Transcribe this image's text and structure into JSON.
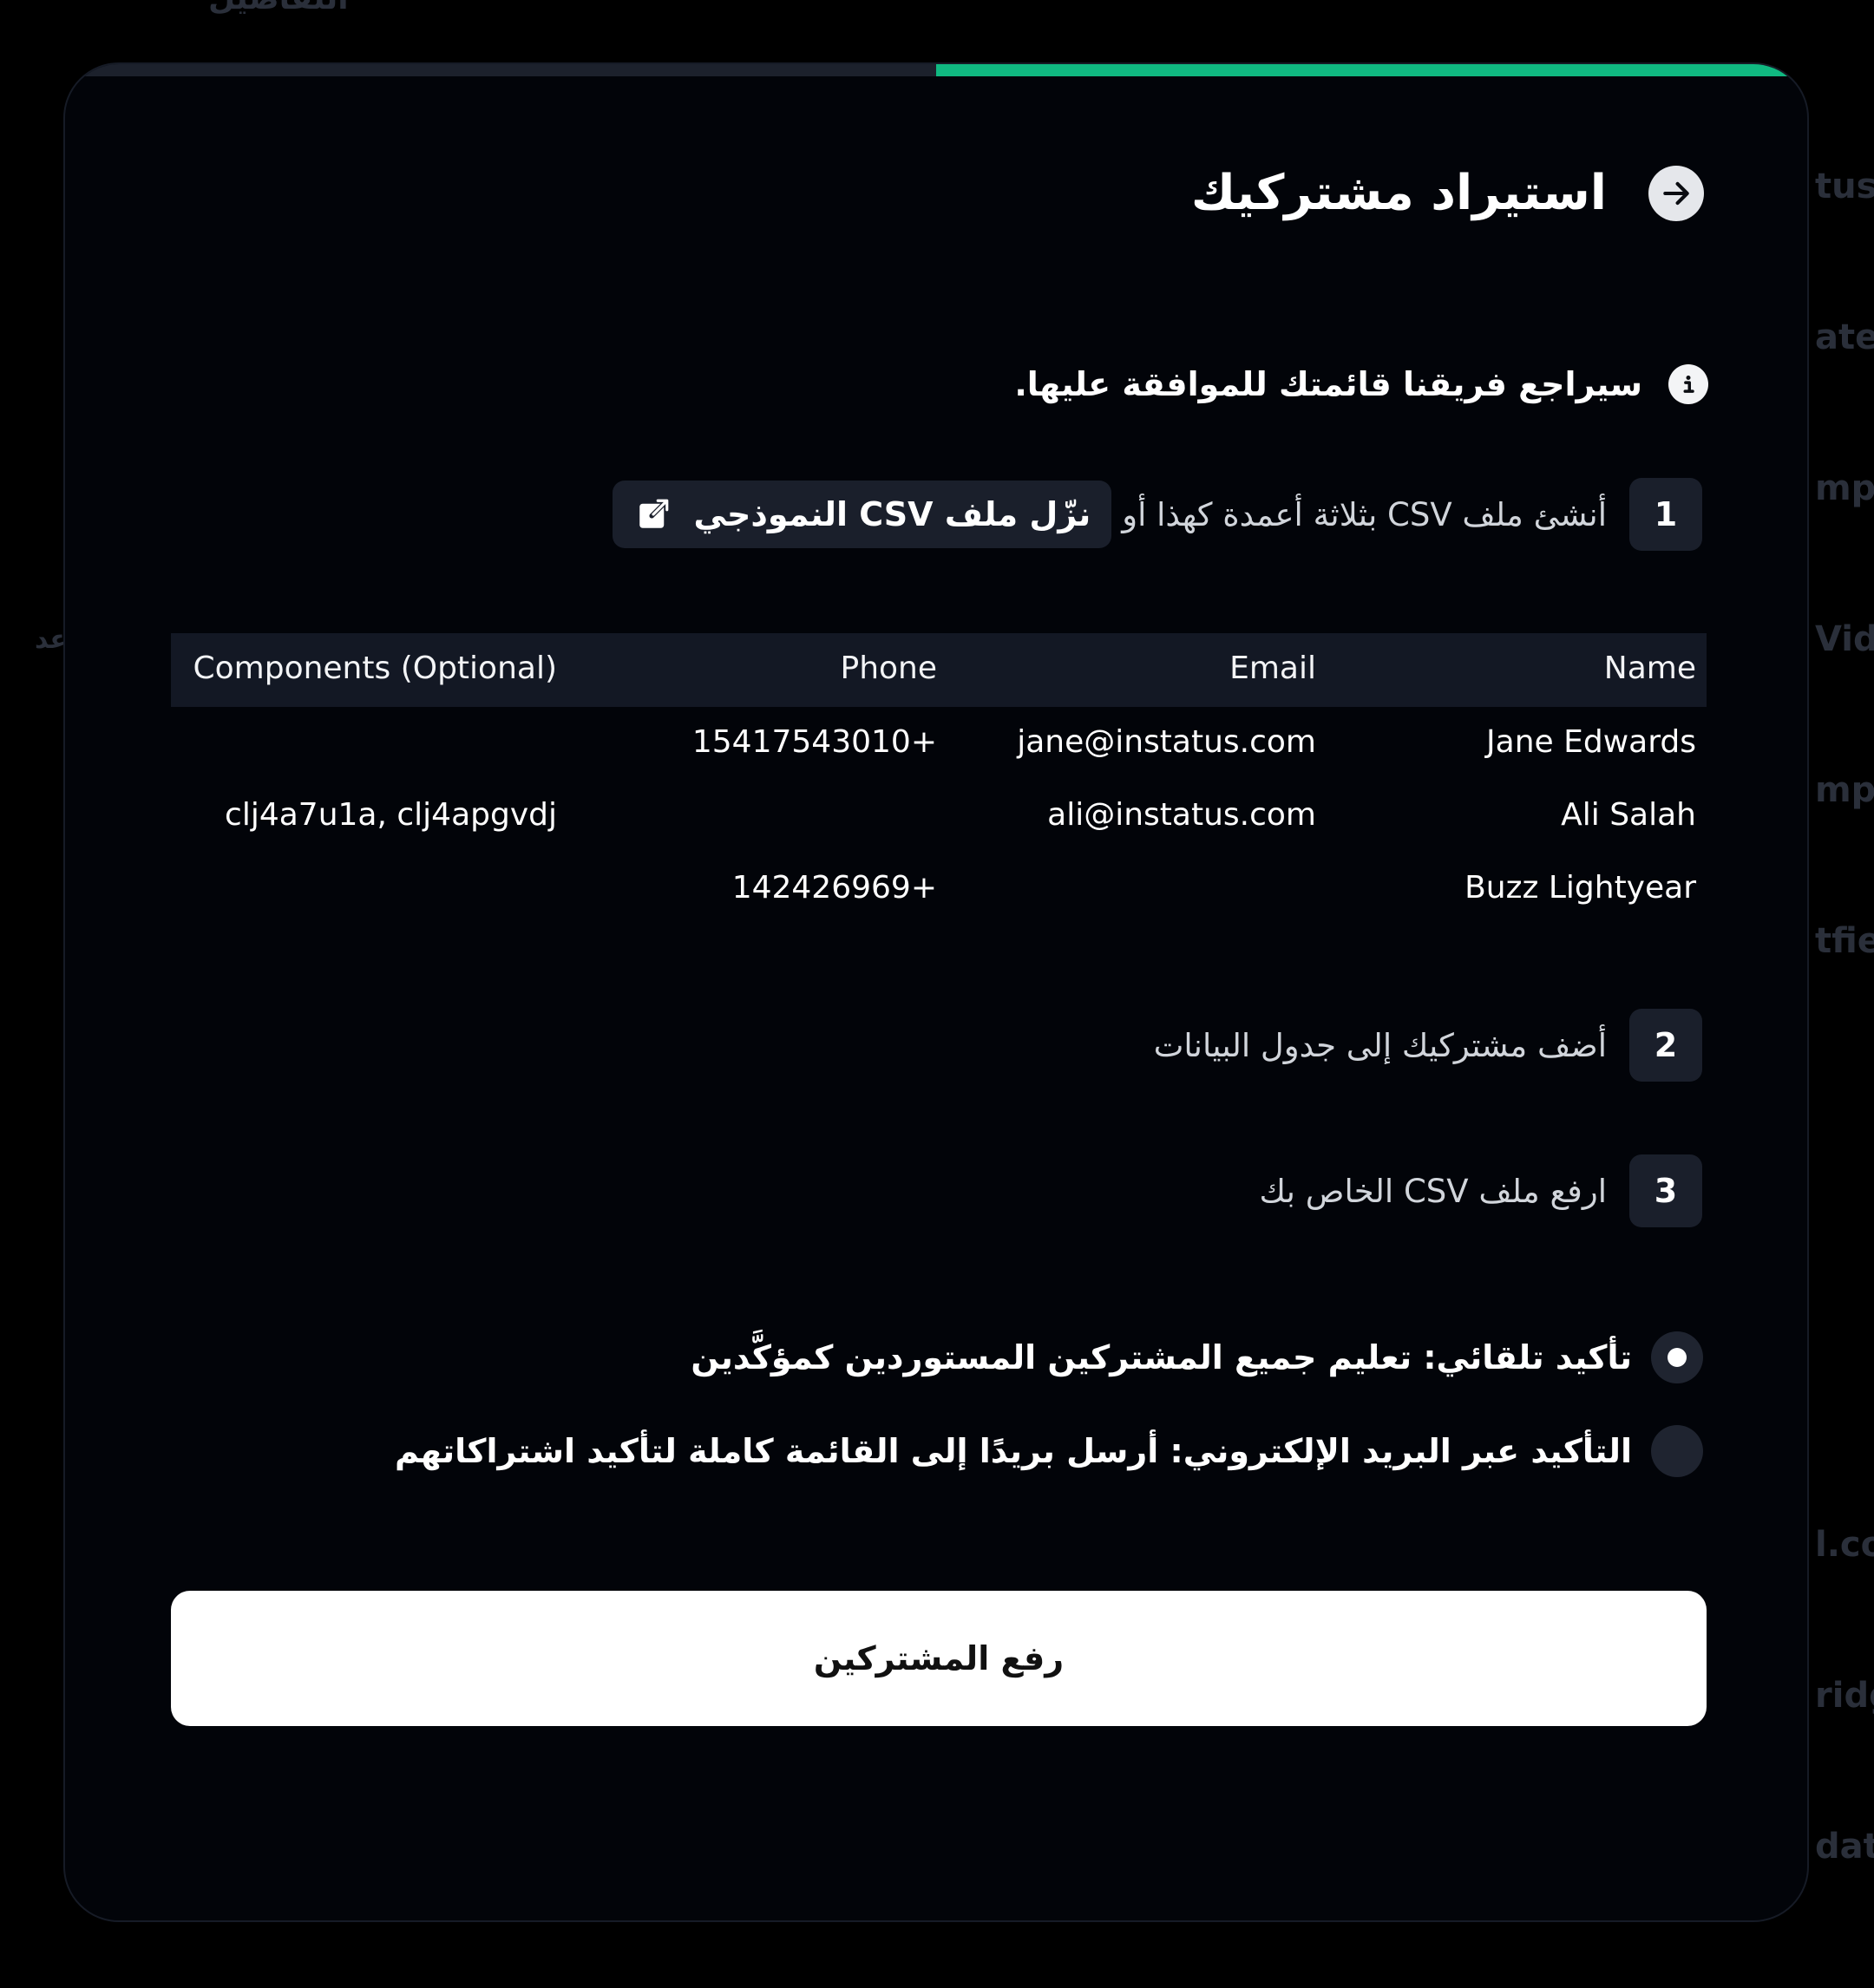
{
  "background": {
    "fragments": [
      "التفاصيل",
      "tus(",
      "aten",
      "mpl",
      "Vid",
      "mpl",
      "tfiel",
      "l.co",
      "ridg",
      "date",
      "عد"
    ]
  },
  "modal": {
    "progress": 0.5,
    "title": "استيراد مشتركيك",
    "back_icon": "arrow-right-icon",
    "info_icon": "info-icon",
    "note": "سيراجع فريقنا قائمتك للموافقة عليها.",
    "steps": [
      {
        "number": "1",
        "text": "أنشئ ملف CSV بثلاثة أعمدة كهذا أو",
        "button_label": "نزّل ملف CSV النموذجي",
        "button_icon": "external-link-icon"
      },
      {
        "number": "2",
        "text": "أضف مشتركيك إلى جدول البيانات"
      },
      {
        "number": "3",
        "text": "ارفع ملف CSV الخاص بك"
      }
    ],
    "table": {
      "headers": {
        "name": "Name",
        "email": "Email",
        "phone": "Phone",
        "components": "Components (Optional)"
      },
      "rows": [
        {
          "name": "Jane Edwards",
          "email": "jane@instatus.com",
          "phone": "15417543010+",
          "components": ""
        },
        {
          "name": "Ali Salah",
          "email": "ali@instatus.com",
          "phone": "",
          "components": "clj4a7u1a, clj4apgvdj"
        },
        {
          "name": "Buzz Lightyear",
          "email": "",
          "phone": "142426969+",
          "components": ""
        }
      ]
    },
    "options": [
      {
        "label": "تأكيد تلقائي: تعليم جميع المشتركين المستوردين كمؤكَّدين",
        "selected": true
      },
      {
        "label": "التأكيد عبر البريد الإلكتروني: أرسل بريدًا إلى القائمة كاملة لتأكيد اشتراكاتهم",
        "selected": false
      }
    ],
    "submit_label": "رفع المشتركين",
    "colors": {
      "accent": "#10b981",
      "surface": "#020409",
      "chip": "#1a1f2b"
    }
  }
}
